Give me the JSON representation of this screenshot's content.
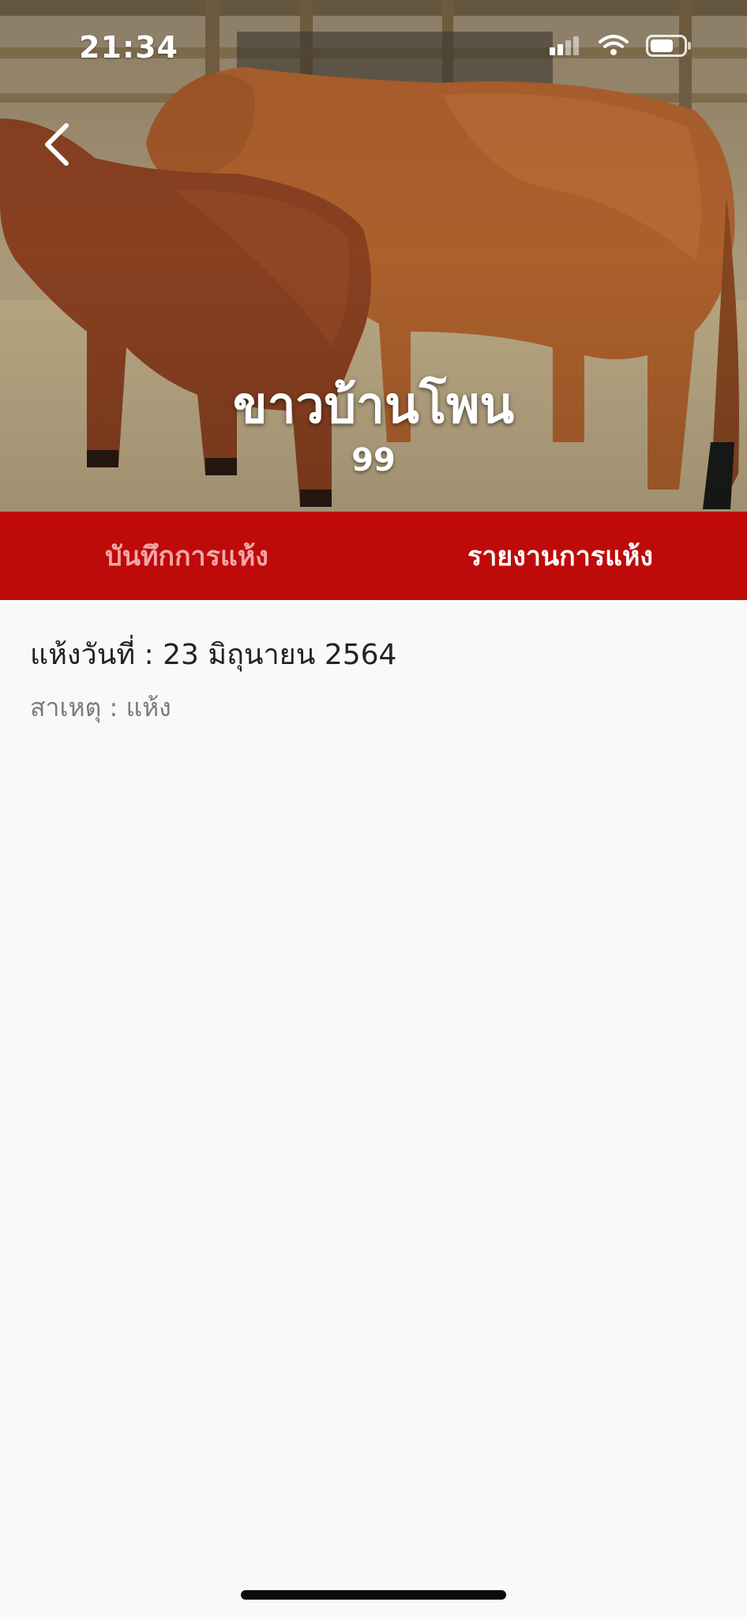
{
  "status_bar": {
    "time": "21:34"
  },
  "header": {
    "animal_name": "ขาวบ้านโพน",
    "animal_number": "99",
    "photo_subject": "two-brown-cows-in-barn"
  },
  "tabs": [
    {
      "label": "บันทึกการแห้ง",
      "state": "inactive"
    },
    {
      "label": "รายงานการแห้ง",
      "state": "active"
    }
  ],
  "record": {
    "dry_date": "แห้งวันที่ : 23 มิถุนายน 2564",
    "reason": "สาเหตุ : แห้ง"
  },
  "colors": {
    "brand_red": "#bf0a0a",
    "inactive_tab_text": "#f3a7a7",
    "background": "#f9f9f9"
  }
}
